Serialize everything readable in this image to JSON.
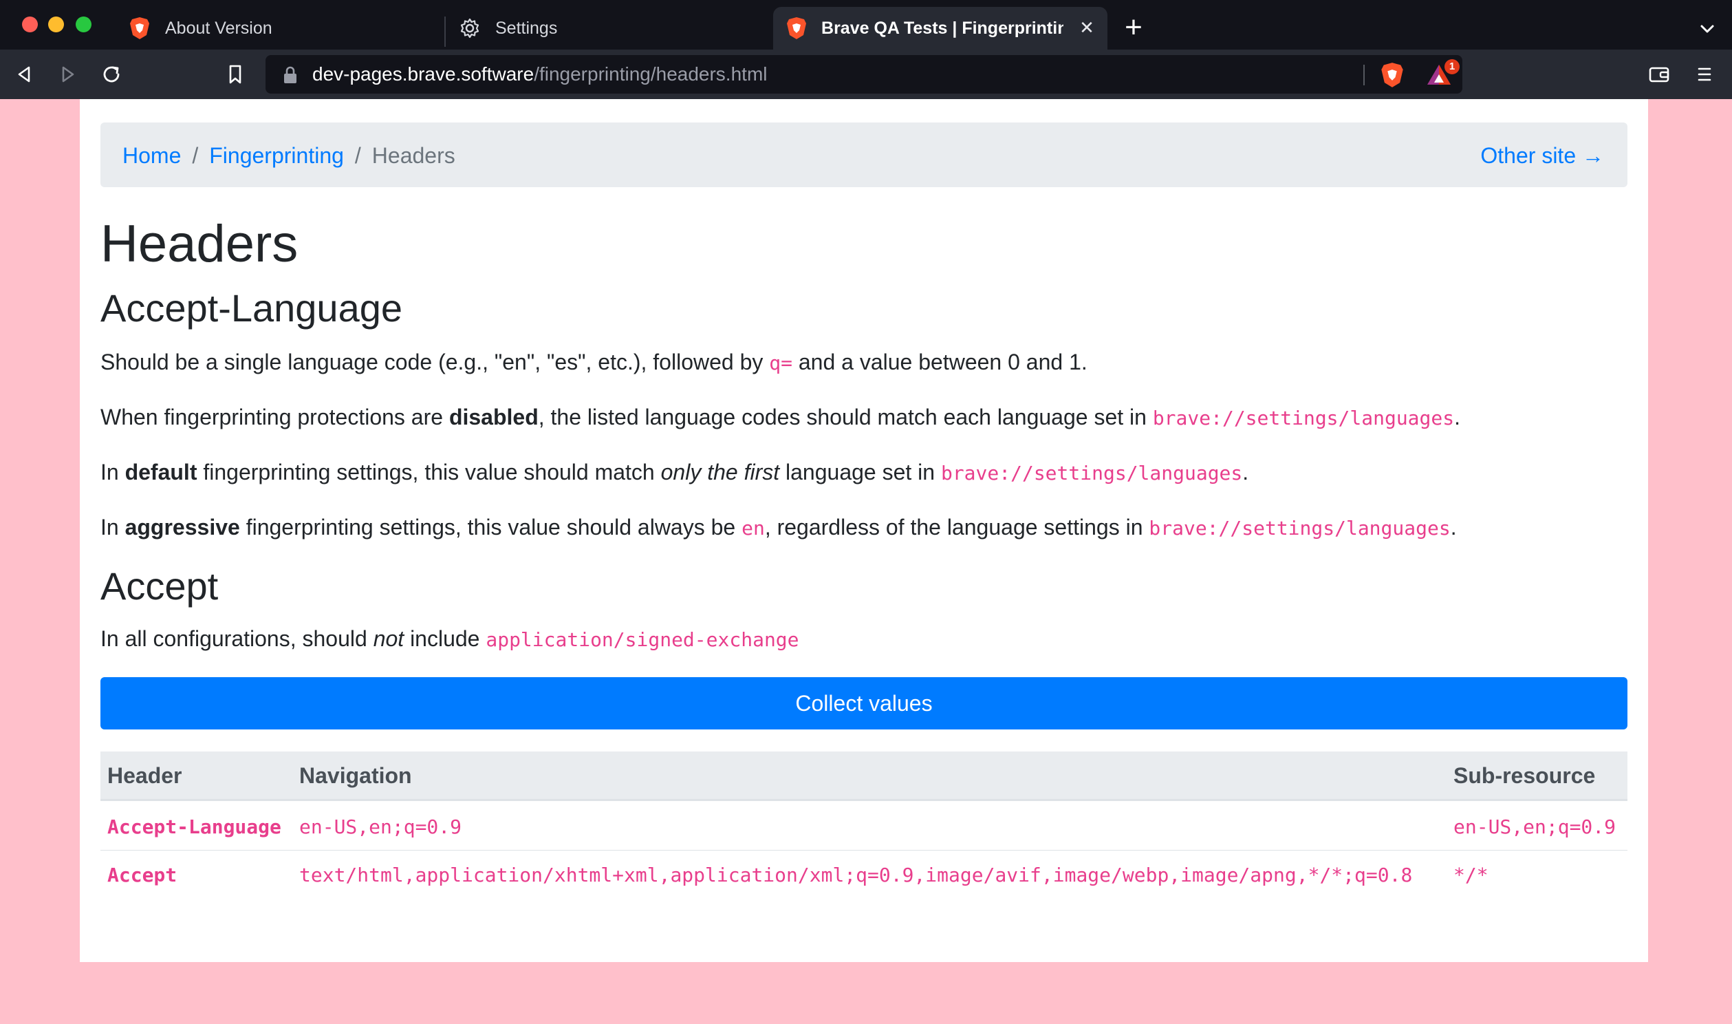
{
  "tabs": [
    {
      "label": "About Version",
      "icon": "brave-lion-icon"
    },
    {
      "label": "Settings",
      "icon": "gear-icon"
    },
    {
      "label": "Brave QA Tests | Fingerprinting",
      "icon": "brave-lion-icon",
      "active": true
    }
  ],
  "tab_close_glyph": "✕",
  "new_tab_glyph": "+",
  "address": {
    "host": "dev-pages.brave.software",
    "path": "/fingerprinting/headers.html"
  },
  "rewards_badge": "1",
  "breadcrumb": {
    "home": "Home",
    "separator": "/",
    "section": "Fingerprinting",
    "current": "Headers",
    "other_site": "Other site →"
  },
  "content": {
    "title": "Headers",
    "accept_language": {
      "heading": "Accept-Language",
      "p1": {
        "a": "Should be a single language code (e.g., \"en\", \"es\", etc.), followed by ",
        "code": "q=",
        "b": " and a value between 0 and 1."
      },
      "p2": {
        "a": "When fingerprinting protections are ",
        "bold": "disabled",
        "b": ", the listed language codes should match each language set in ",
        "code": "brave://settings/languages",
        "c": "."
      },
      "p3": {
        "a": "In ",
        "bold": "default",
        "b": " fingerprinting settings, this value should match ",
        "italic": "only the first",
        "c": " language set in ",
        "code": "brave://settings/languages",
        "d": "."
      },
      "p4": {
        "a": "In ",
        "bold": "aggressive",
        "b": " fingerprinting settings, this value should always be ",
        "code1": "en",
        "c": ", regardless of the language settings in ",
        "code2": "brave://settings/languages",
        "d": "."
      }
    },
    "accept": {
      "heading": "Accept",
      "p1": {
        "a": "In all configurations, should ",
        "italic": "not",
        "b": " include ",
        "code": "application/signed-exchange"
      }
    },
    "collect_button": "Collect values"
  },
  "table": {
    "headers": [
      "Header",
      "Navigation",
      "Sub-resource"
    ],
    "rows": [
      {
        "header": "Accept-Language",
        "navigation": "en-US,en;q=0.9",
        "subresource": "en-US,en;q=0.9"
      },
      {
        "header": "Accept",
        "navigation": "text/html,application/xhtml+xml,application/xml;q=0.9,image/avif,image/webp,image/apng,*/*;q=0.8",
        "subresource": "*/*"
      }
    ]
  },
  "colors": {
    "page_bg": "#ffc0cb",
    "link": "#007bff",
    "code": "#e83e8c",
    "button": "#007bff",
    "chrome_dark": "#12131a",
    "toolbar": "#272a33"
  }
}
